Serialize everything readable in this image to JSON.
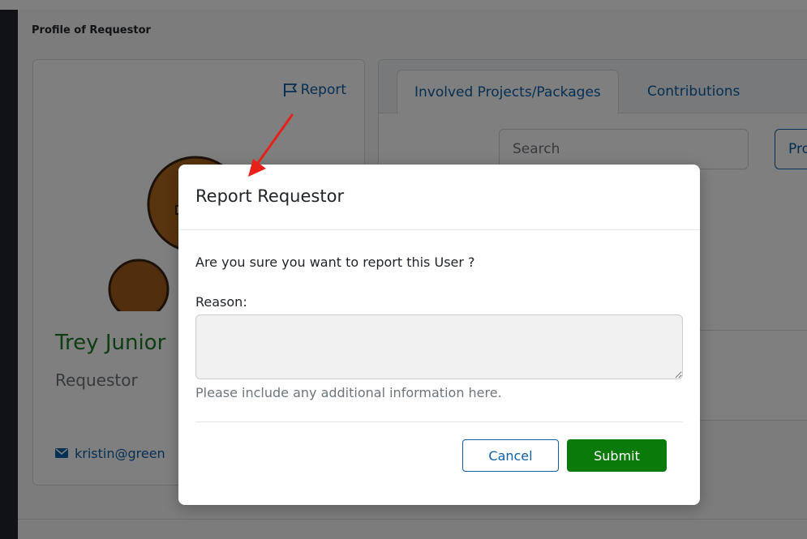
{
  "page": {
    "section_title": "Profile of Requestor"
  },
  "profile": {
    "report_label": "Report",
    "name": "Trey Junior",
    "role": "Requestor",
    "email": "kristin@green"
  },
  "tabs": [
    {
      "label": "Involved Projects/Packages",
      "active": true
    },
    {
      "label": "Contributions",
      "active": false
    }
  ],
  "filter": {
    "search_placeholder": "Search",
    "button_label": "Pro"
  },
  "modal": {
    "title": "Report Requestor",
    "question": "Are you sure you want to report this User ?",
    "reason_label": "Reason:",
    "reason_value": "",
    "reason_help": "Please include any additional information here.",
    "cancel_label": "Cancel",
    "submit_label": "Submit"
  },
  "colors": {
    "link": "#0d5fa8",
    "name_green": "#1d7a27",
    "submit_green": "#0a7a0a",
    "annotation_arrow": "#e8201a"
  }
}
